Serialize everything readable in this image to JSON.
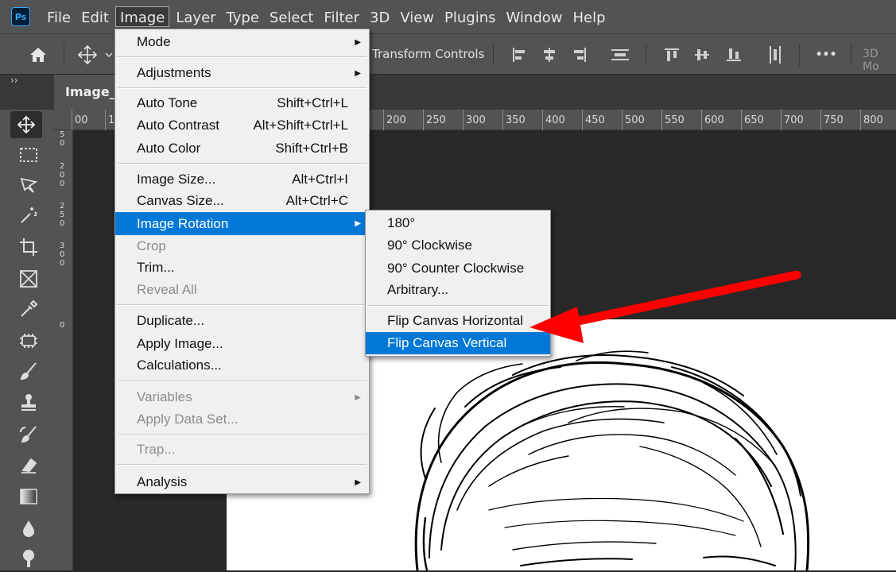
{
  "app": {
    "logo": "Ps"
  },
  "menubar": [
    {
      "label": "File"
    },
    {
      "label": "Edit"
    },
    {
      "label": "Image",
      "open": true
    },
    {
      "label": "Layer"
    },
    {
      "label": "Type"
    },
    {
      "label": "Select"
    },
    {
      "label": "Filter"
    },
    {
      "label": "3D"
    },
    {
      "label": "View"
    },
    {
      "label": "Plugins"
    },
    {
      "label": "Window"
    },
    {
      "label": "Help"
    }
  ],
  "options_bar": {
    "transform_controls_label": "Transform Controls",
    "more_label": "•••",
    "threed_label": "3D Mo"
  },
  "tabbar": {
    "collapse_label": "››",
    "document_tab": "Image_f"
  },
  "ruler_top": [
    "00",
    "1",
    "200",
    "250",
    "300",
    "350",
    "400",
    "450",
    "500",
    "550",
    "600",
    "650",
    "700",
    "750",
    "800"
  ],
  "ruler_left": [
    "5 0",
    "2 0 0",
    "2 5 0",
    "3 0 0",
    "0"
  ],
  "image_menu": {
    "items": [
      {
        "label": "Mode",
        "submenu": true
      },
      {
        "label": "Adjustments",
        "submenu": true
      },
      {
        "label": "Auto Tone",
        "shortcut": "Shift+Ctrl+L"
      },
      {
        "label": "Auto Contrast",
        "shortcut": "Alt+Shift+Ctrl+L"
      },
      {
        "label": "Auto Color",
        "shortcut": "Shift+Ctrl+B"
      },
      {
        "label": "Image Size...",
        "shortcut": "Alt+Ctrl+I"
      },
      {
        "label": "Canvas Size...",
        "shortcut": "Alt+Ctrl+C"
      },
      {
        "label": "Image Rotation",
        "submenu": true,
        "highlighted": true
      },
      {
        "label": "Crop",
        "disabled": true
      },
      {
        "label": "Trim..."
      },
      {
        "label": "Reveal All",
        "disabled": true
      },
      {
        "label": "Duplicate..."
      },
      {
        "label": "Apply Image..."
      },
      {
        "label": "Calculations..."
      },
      {
        "label": "Variables",
        "submenu": true,
        "disabled": true
      },
      {
        "label": "Apply Data Set...",
        "disabled": true
      },
      {
        "label": "Trap...",
        "disabled": true
      },
      {
        "label": "Analysis",
        "submenu": true
      }
    ]
  },
  "rotation_menu": {
    "items": [
      {
        "label": "180°"
      },
      {
        "label": "90° Clockwise"
      },
      {
        "label": "90° Counter Clockwise"
      },
      {
        "label": "Arbitrary..."
      },
      {
        "label": "Flip Canvas Horizontal"
      },
      {
        "label": "Flip Canvas Vertical",
        "highlighted": true
      }
    ]
  },
  "colors": {
    "highlight": "#0078d7",
    "annotation_arrow": "#ff0000",
    "menu_bg": "#f0f0f0",
    "chrome": "#535353"
  }
}
